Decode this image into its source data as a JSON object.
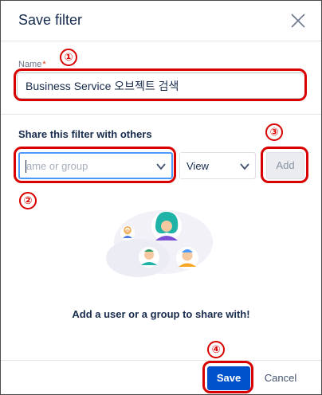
{
  "dialog": {
    "title": "Save filter",
    "close_icon": "close-icon"
  },
  "name_field": {
    "label": "Name",
    "required_mark": "*",
    "value": "Business Service 오브젝트 검색"
  },
  "share": {
    "heading": "Share this filter with others",
    "group_placeholder": "Name or group",
    "group_visible_placeholder": "ame or group",
    "permission_value": "View",
    "add_label": "Add",
    "empty_message": "Add a user or a group to share with!"
  },
  "footer": {
    "save_label": "Save",
    "cancel_label": "Cancel"
  },
  "annotations": {
    "marker1": "①",
    "marker2": "②",
    "marker3": "③",
    "marker4": "④",
    "color": "#d90000"
  },
  "colors": {
    "primary": "#0052cc",
    "focus_border": "#4c9aff",
    "text": "#172b4d",
    "muted": "#6b778c"
  }
}
